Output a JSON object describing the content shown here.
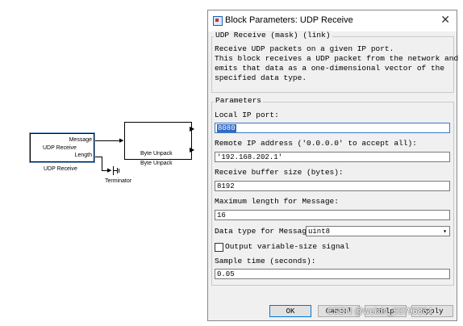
{
  "canvas": {
    "udp_block": {
      "port_message": "Message",
      "title": "UDP Receive",
      "port_length": "Length",
      "caption": "UDP Receive"
    },
    "unpack_block": {
      "inner_label": "Byte Unpack",
      "caption": "Byte Unpack"
    },
    "terminator_caption": "Terminator"
  },
  "dialog": {
    "title": "Block Parameters: UDP Receive",
    "close_glyph": "✕",
    "mask_legend": "UDP Receive (mask) (link)",
    "mask_desc_line1": "Receive UDP packets on a given IP port.",
    "mask_desc_line2": "This block receives a UDP packet from the network and",
    "mask_desc_line3": "emits that data as a one-dimensional vector of the",
    "mask_desc_line4": "specified data type.",
    "params_legend": "Parameters",
    "local_port_label": "Local IP port:",
    "local_port_value": "8080",
    "remote_ip_label": "Remote IP address ('0.0.0.0' to accept all):",
    "remote_ip_value": "'192.168.202.1'",
    "buffer_label": "Receive buffer size (bytes):",
    "buffer_value": "8192",
    "maxlen_label": "Maximum length for Message:",
    "maxlen_value": "16",
    "dtype_label": "Data type for Message:",
    "dtype_value": "uint8",
    "dtype_arrow": "▾",
    "varsize_label": "Output variable-size signal",
    "varsize_checked": false,
    "sample_label": "Sample time (seconds):",
    "sample_value": "0.05",
    "buttons": {
      "ok": "OK",
      "cancel": "Cancel",
      "help": "Help",
      "apply": "Apply"
    }
  },
  "watermark": "CSDN @weixin_53796864"
}
